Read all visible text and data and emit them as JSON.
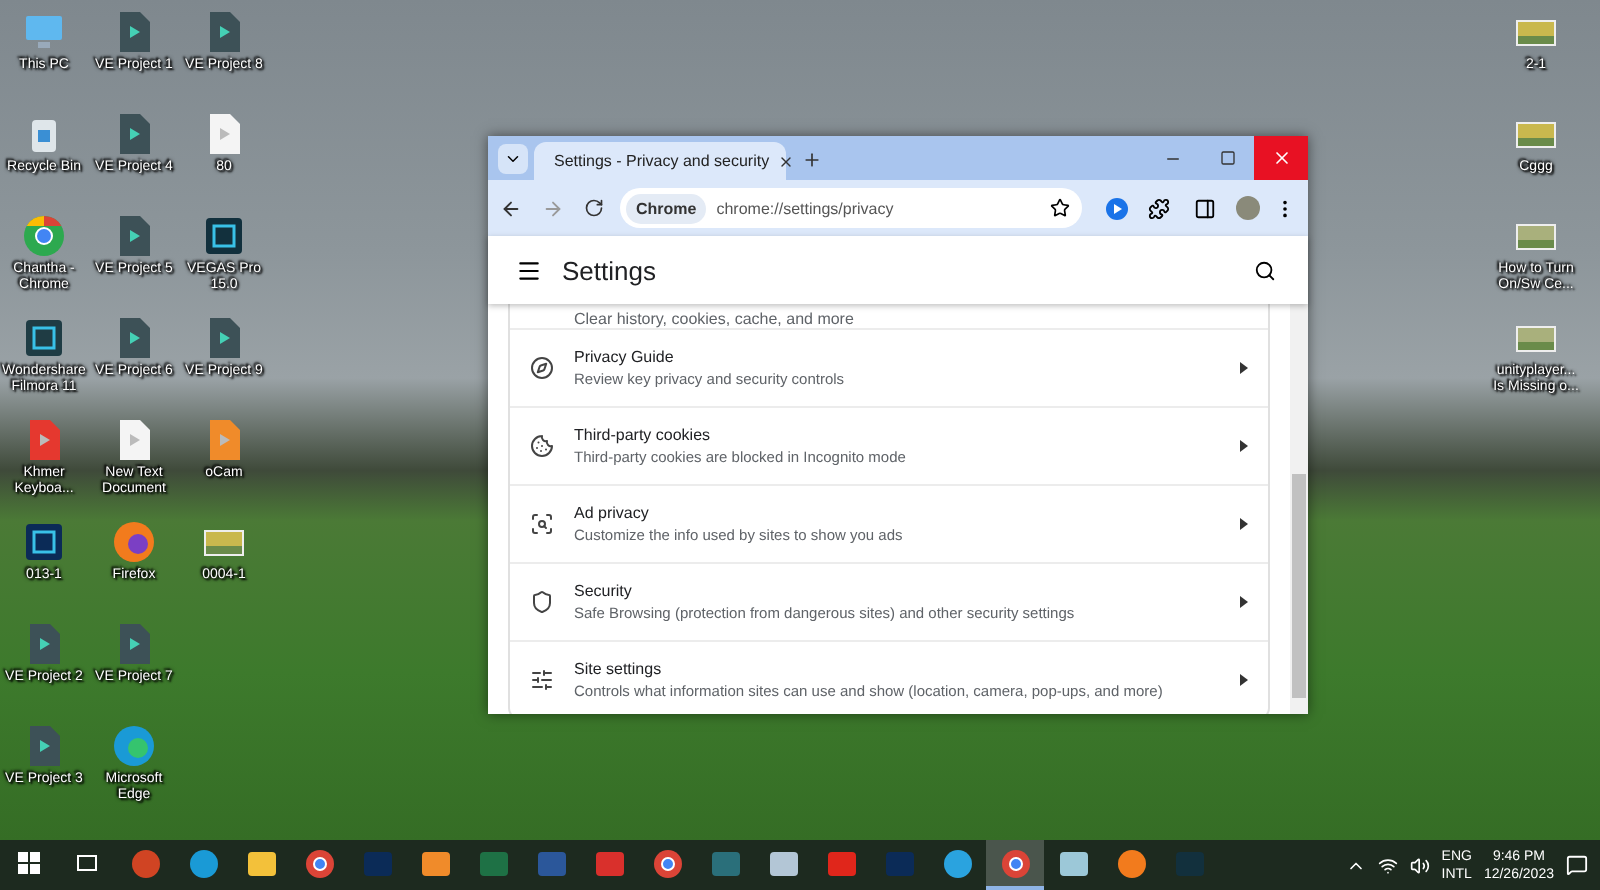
{
  "desktop_icons": {
    "columns": [
      [
        {
          "label": "This PC",
          "kind": "pc"
        },
        {
          "label": "Recycle Bin",
          "kind": "bin"
        },
        {
          "label": "Chantha - Chrome",
          "kind": "chrome"
        },
        {
          "label": "Wondershare Filmora 11",
          "kind": "filmora"
        },
        {
          "label": "Khmer Keyboa...",
          "kind": "pdf"
        },
        {
          "label": "013-1",
          "kind": "psd"
        },
        {
          "label": "VE Project 2",
          "kind": "project"
        },
        {
          "label": "VE Project 3",
          "kind": "project"
        }
      ],
      [
        {
          "label": "VE Project 1",
          "kind": "project"
        },
        {
          "label": "VE Project 4",
          "kind": "project"
        },
        {
          "label": "VE Project 5",
          "kind": "project"
        },
        {
          "label": "VE Project 6",
          "kind": "project"
        },
        {
          "label": "New Text Document",
          "kind": "doc"
        },
        {
          "label": "Firefox",
          "kind": "firefox"
        },
        {
          "label": "VE Project 7",
          "kind": "project"
        },
        {
          "label": "Microsoft Edge",
          "kind": "edge"
        }
      ],
      [
        {
          "label": "VE Project 8",
          "kind": "project"
        },
        {
          "label": "80",
          "kind": "doc"
        },
        {
          "label": "VEGAS Pro 15.0",
          "kind": "vegas"
        },
        {
          "label": "VE Project 9",
          "kind": "project"
        },
        {
          "label": "oCam",
          "kind": "ocam"
        },
        {
          "label": "0004-1",
          "kind": "image"
        }
      ]
    ],
    "right_column": [
      {
        "label": "2-1",
        "kind": "image"
      },
      {
        "label": "Cggg",
        "kind": "image"
      },
      {
        "label": "How to Turn On/Sw Ce...",
        "kind": "video"
      },
      {
        "label": "unityplayer... Is Missing o...",
        "kind": "video"
      }
    ]
  },
  "browser": {
    "tab": {
      "title": "Settings - Privacy and security",
      "selected": true
    },
    "address": {
      "chip": "Chrome",
      "url": "chrome://settings/privacy"
    },
    "header": {
      "title": "Settings"
    },
    "partial_row": {
      "description": "Clear history, cookies, cache, and more"
    },
    "rows": [
      {
        "kind": "guide",
        "title": "Privacy Guide",
        "description": "Review key privacy and security controls"
      },
      {
        "kind": "cookies",
        "title": "Third-party cookies",
        "description": "Third-party cookies are blocked in Incognito mode"
      },
      {
        "kind": "ads",
        "title": "Ad privacy",
        "description": "Customize the info used by sites to show you ads"
      },
      {
        "kind": "security",
        "title": "Security",
        "description": "Safe Browsing (protection from dangerous sites) and other security settings"
      },
      {
        "kind": "site",
        "title": "Site settings",
        "description": "Controls what information sites can use and show (location, camera, pop-ups, and more)"
      }
    ]
  },
  "taskbar": {
    "apps": [
      {
        "kind": "start",
        "selected": false
      },
      {
        "kind": "taskview",
        "selected": false
      },
      {
        "kind": "powerpoint",
        "selected": false
      },
      {
        "kind": "edge",
        "selected": false
      },
      {
        "kind": "folder",
        "selected": false
      },
      {
        "kind": "chrome",
        "selected": false
      },
      {
        "kind": "photoshop",
        "selected": false
      },
      {
        "kind": "ocam",
        "selected": false
      },
      {
        "kind": "excel",
        "selected": false
      },
      {
        "kind": "word",
        "selected": false
      },
      {
        "kind": "diamond",
        "selected": false
      },
      {
        "kind": "chrome",
        "selected": false
      },
      {
        "kind": "installer",
        "selected": false
      },
      {
        "kind": "paint",
        "selected": false
      },
      {
        "kind": "acrobat",
        "selected": false
      },
      {
        "kind": "photoshop",
        "selected": false
      },
      {
        "kind": "telegram",
        "selected": false
      },
      {
        "kind": "chrome",
        "selected": true
      },
      {
        "kind": "notes",
        "selected": false
      },
      {
        "kind": "firefox",
        "selected": false
      },
      {
        "kind": "vegas",
        "selected": false
      }
    ],
    "tray": {
      "language": "ENG",
      "layout": "INTL",
      "time": "9:46 PM",
      "date": "12/26/2023"
    }
  }
}
